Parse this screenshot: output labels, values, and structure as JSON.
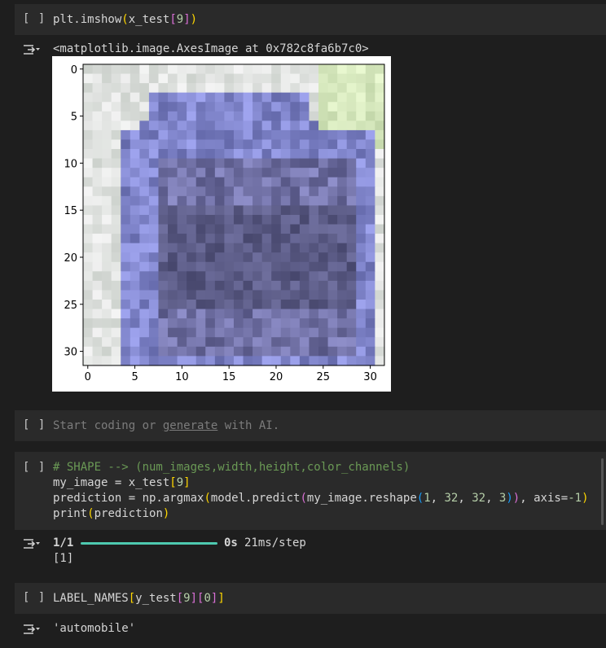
{
  "cells": {
    "c1": {
      "run_label": "[ ]",
      "code": {
        "plain": "plt.imshow",
        "br_open": "(",
        "arg": "x_test",
        "br2_open": "[",
        "idx": "9",
        "br2_close": "]",
        "br_close": ")"
      },
      "output_text": "<matplotlib.image.AxesImage at 0x782c8fa6b7c0>"
    },
    "c2": {
      "run_label": "[ ]",
      "placeholder_start": "Start coding or ",
      "placeholder_link": "generate",
      "placeholder_end": " with AI."
    },
    "c3": {
      "run_label": "[ ]",
      "line1": "# SHAPE --> (num_images,width,height,color_channels)",
      "line2": {
        "plain": "my_image = x_test",
        "b_open": "[",
        "idx": "9",
        "b_close": "]"
      },
      "line3": {
        "a": "prediction = np.argmax",
        "p1": "(",
        "b": "model.predict",
        "p2": "(",
        "c": "my_image.reshape",
        "p3": "(",
        "n1": "1",
        ",1": ", ",
        "n2": "32",
        ",2": ", ",
        "n3": "32",
        ",3": ", ",
        "n4": "3",
        "p3c": ")",
        "p2c": ")",
        "d": ", axis=",
        "n5": "-1",
        "p1c": ")"
      },
      "line4": {
        "a": "print",
        "p": "(",
        "b": "prediction",
        "pc": ")"
      },
      "progress_label": "1/1",
      "progress_time": "0s",
      "progress_rate": "21ms/step",
      "output_value": "[1]"
    },
    "c4": {
      "run_label": "[ ]",
      "code": {
        "a": "LABEL_NAMES",
        "b1": "[",
        "b": "y_test",
        "b2": "[",
        "n1": "9",
        "b2c": "]",
        "b3": "[",
        "n2": "0",
        "b3c": "]",
        "b1c": "]"
      },
      "output_text": "'automobile'"
    }
  },
  "chart_data": {
    "type": "heatmap",
    "description_grid": "32x32 pixel RGB image",
    "x_ticks": [
      "0",
      "5",
      "10",
      "15",
      "20",
      "25",
      "30"
    ],
    "y_ticks": [
      "0",
      "5",
      "10",
      "15",
      "20",
      "25",
      "30"
    ],
    "xlim": [
      -0.5,
      31.5
    ],
    "ylim": [
      31.5,
      -0.5
    ]
  }
}
